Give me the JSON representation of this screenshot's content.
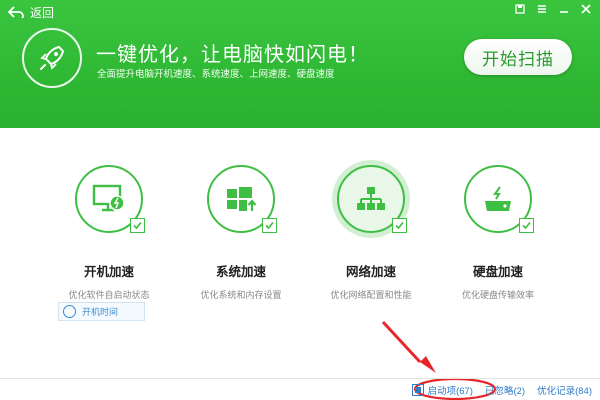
{
  "topbar": {
    "back_label": "返回"
  },
  "header": {
    "title": "一键优化，让电脑快如闪电！",
    "subtitle": "全面提升电脑开机速度、系统速度、上网速度、硬盘速度",
    "scan_button": "开始扫描"
  },
  "cards": [
    {
      "title": "开机加速",
      "desc": "优化软件自启动状态",
      "icon": "monitor-power-icon",
      "checked": true
    },
    {
      "title": "系统加速",
      "desc": "优化系统和内存设置",
      "icon": "windows-icon",
      "checked": true
    },
    {
      "title": "网络加速",
      "desc": "优化网络配置和性能",
      "icon": "network-icon",
      "checked": true,
      "active": true
    },
    {
      "title": "硬盘加速",
      "desc": "优化硬盘传输效率",
      "icon": "harddisk-icon",
      "checked": true
    }
  ],
  "boot_time_button": "开机时间",
  "bottom": {
    "startup_items": "启动项(67)",
    "ignored": "已忽略(2)",
    "history": "优化记录(84)"
  },
  "colors": {
    "brand_green": "#2fb834",
    "link_blue": "#2e7bc9",
    "arrow_red": "#e8262a"
  }
}
